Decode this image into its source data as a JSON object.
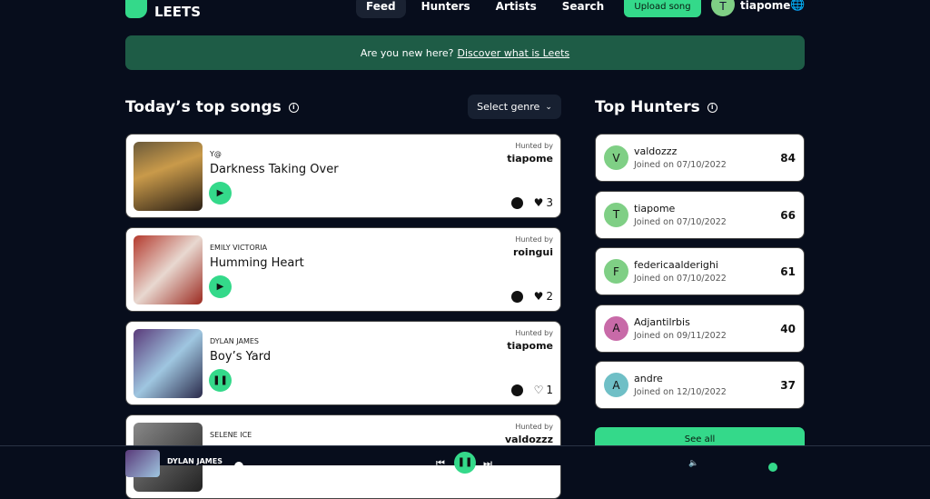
{
  "brand": "LEETS",
  "nav": [
    "Feed",
    "Hunters",
    "Artists",
    "Search"
  ],
  "upload": "Upload song",
  "user": {
    "initial": "T",
    "name": "tiapome"
  },
  "banner": {
    "text": "Are you new here?",
    "link": "Discover what is Leets"
  },
  "songs_title": "Today’s top songs",
  "genre": "Select genre",
  "hunted_by": "Hunted by",
  "songs": [
    {
      "artist": "Y@",
      "title": "Darkness Taking Over",
      "hunter": "tiapome",
      "likes": "3",
      "playing": false,
      "liked": true,
      "art": "linear-gradient(160deg,#6b5a3a,#c99a4a 40%,#2a1f15)"
    },
    {
      "artist": "EMILY VICTORIA",
      "title": "Humming Heart",
      "hunter": "roingui",
      "likes": "2",
      "playing": false,
      "liked": true,
      "art": "linear-gradient(135deg,#b43a2e,#e8d8d0 50%,#9c2a20)"
    },
    {
      "artist": "DYLAN JAMES",
      "title": "Boy’s Yard",
      "hunter": "tiapome",
      "likes": "1",
      "playing": true,
      "liked": false,
      "art": "linear-gradient(135deg,#5a3a7a,#9fc6e0 50%,#2a2a4a)"
    },
    {
      "artist": "SELENE ICE",
      "title": "",
      "hunter": "valdozzz",
      "likes": "",
      "playing": false,
      "liked": false,
      "art": "linear-gradient(135deg,#888,#222)"
    }
  ],
  "hunters_title": "Top Hunters",
  "hunters": [
    {
      "initial": "V",
      "name": "valdozzz",
      "joined": "Joined on 07/10/2022",
      "score": "84",
      "color": "#7fcf85"
    },
    {
      "initial": "T",
      "name": "tiapome",
      "joined": "Joined on 07/10/2022",
      "score": "66",
      "color": "#7fcf85"
    },
    {
      "initial": "F",
      "name": "federicaalderighi",
      "joined": "Joined on 07/10/2022",
      "score": "61",
      "color": "#7fcf85"
    },
    {
      "initial": "A",
      "name": "Adjantilrbis",
      "joined": "Joined on 09/11/2022",
      "score": "40",
      "color": "#c86aa8"
    },
    {
      "initial": "A",
      "name": "andre",
      "joined": "Joined on 12/10/2022",
      "score": "37",
      "color": "#6fbfc6"
    }
  ],
  "see_all": "See all",
  "player": {
    "artist": "DYLAN JAMES"
  }
}
